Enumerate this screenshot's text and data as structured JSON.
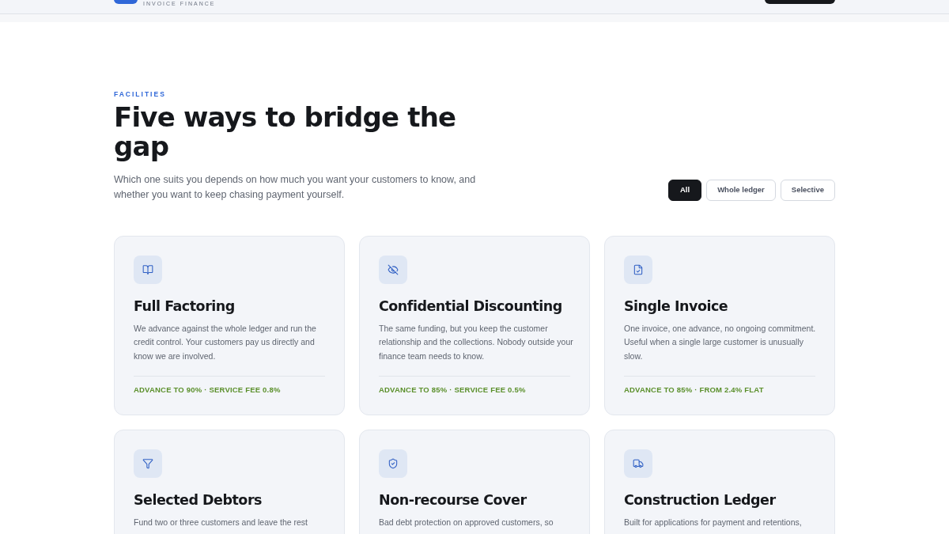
{
  "header": {
    "tagline": "INVOICE FINANCE"
  },
  "section": {
    "eyebrow": "FACILITIES",
    "title": "Five ways to bridge the gap",
    "intro": "Which one suits you depends on how much you want your customers to know, and whether you want to keep chasing payment yourself."
  },
  "filters": [
    {
      "label": "All",
      "selected": true
    },
    {
      "label": "Whole ledger",
      "selected": false
    },
    {
      "label": "Selective",
      "selected": false
    }
  ],
  "cards": [
    {
      "title": "Full Factoring",
      "description": "We advance against the whole ledger and run the credit control. Your customers pay us directly and know we are involved.",
      "terms": "ADVANCE TO 90% · SERVICE FEE 0.8%"
    },
    {
      "title": "Confidential Discounting",
      "description": "The same funding, but you keep the customer relationship and the collections. Nobody outside your finance team needs to know.",
      "terms": "ADVANCE TO 85% · SERVICE FEE 0.5%"
    },
    {
      "title": "Single Invoice",
      "description": "One invoice, one advance, no ongoing commitment. Useful when a single large customer is unusually slow.",
      "terms": "ADVANCE TO 85% · FROM 2.4% FLAT"
    },
    {
      "title": "Selected Debtors",
      "description": "Fund two or three customers and leave the rest"
    },
    {
      "title": "Non-recourse Cover",
      "description": "Bad debt protection on approved customers, so"
    },
    {
      "title": "Construction Ledger",
      "description": "Built for applications for payment and retentions,"
    }
  ]
}
